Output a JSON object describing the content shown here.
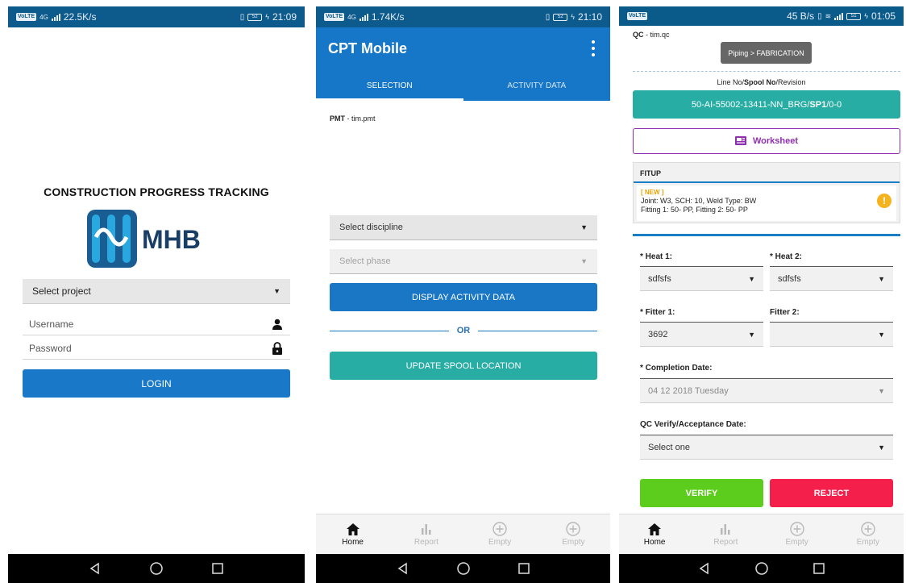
{
  "screen1": {
    "status": {
      "speed": "22.5K/s",
      "time": "21:09",
      "network": "4G",
      "chip": "VoLTE",
      "battery": "52"
    },
    "app_title": "CONSTRUCTION PROGRESS TRACKING",
    "logo_text": "MHB",
    "project_select": "Select project",
    "username_placeholder": "Username",
    "password_placeholder": "Password",
    "login_label": "LOGIN"
  },
  "screen2": {
    "status": {
      "speed": "1.74K/s",
      "time": "21:10",
      "network": "4G",
      "chip": "VoLTE",
      "battery": "52"
    },
    "app_title": "CPT Mobile",
    "tabs": [
      {
        "label": "SELECTION"
      },
      {
        "label": "ACTIVITY DATA"
      }
    ],
    "pmt_label": "PMT",
    "pmt_user": " - tim.pmt",
    "discipline_select": "Select discipline",
    "phase_select": "Select phase",
    "display_button": "DISPLAY ACTIVITY DATA",
    "or_text": "OR",
    "update_button": "UPDATE SPOOL LOCATION"
  },
  "screen3": {
    "status": {
      "speed": "45 B/s",
      "time": "01:05",
      "chip": "VoLTE",
      "battery": "51"
    },
    "qc_label": "QC",
    "qc_user": " - tim.qc",
    "breadcrumb": "Piping > FABRICATION",
    "lineno_pre": "Line No/",
    "lineno_bold": "Spool No",
    "lineno_post": "/Revision",
    "lineno_value_pre": "50-AI-55002-13411-NN_BRG/",
    "lineno_value_bold": "SP1",
    "lineno_value_post": "/0-0",
    "worksheet_label": "Worksheet",
    "fitup": {
      "header": "FITUP",
      "badge": "[ NEW ]",
      "line1": "Joint: W3, SCH: 10, Weld Type: BW",
      "line2": "Fitting 1: 50- PP, Fitting 2: 50- PP",
      "warn": "!"
    },
    "heat1_label": "* Heat 1:",
    "heat1_value": "sdfsfs",
    "heat2_label": "* Heat 2:",
    "heat2_value": "sdfsfs",
    "fitter1_label": "* Fitter 1:",
    "fitter1_value": "3692",
    "fitter2_label": "Fitter 2:",
    "fitter2_value": "",
    "completion_label": "* Completion Date:",
    "completion_value": "04 12 2018 Tuesday",
    "qc_date_label": "QC Verify/Acceptance Date:",
    "qc_date_value": "Select one",
    "verify_label": "VERIFY",
    "reject_label": "REJECT"
  },
  "bottom_nav": [
    {
      "label": "Home",
      "icon": "home-icon"
    },
    {
      "label": "Report",
      "icon": "bar-chart-icon"
    },
    {
      "label": "Empty",
      "icon": "plus-circle-icon"
    },
    {
      "label": "Empty",
      "icon": "plus-circle-icon"
    }
  ],
  "colors": {
    "status_bar": "#0d5a8c",
    "primary_blue": "#1676c7",
    "teal": "#27ada3",
    "purple": "#8e2faf",
    "verify_green": "#5ccd1d",
    "reject_red": "#f51f4b",
    "warn_orange": "#f5b31f"
  }
}
